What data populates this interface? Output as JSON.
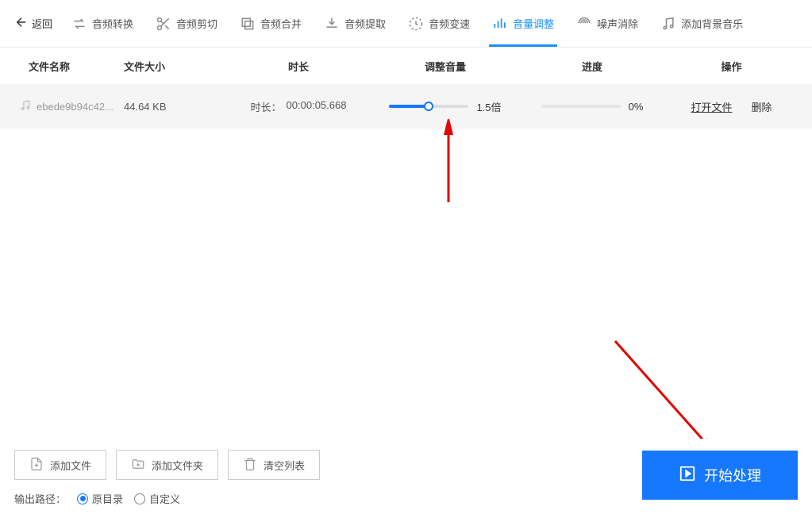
{
  "toolbar": {
    "back": "返回",
    "tabs": [
      {
        "label": "音频转换"
      },
      {
        "label": "音频剪切"
      },
      {
        "label": "音频合并"
      },
      {
        "label": "音频提取"
      },
      {
        "label": "音频变速"
      },
      {
        "label": "音量调整"
      },
      {
        "label": "噪声消除"
      },
      {
        "label": "添加背景音乐"
      }
    ]
  },
  "table": {
    "headers": {
      "name": "文件名称",
      "size": "文件大小",
      "duration": "时长",
      "volume": "调整音量",
      "progress": "进度",
      "action": "操作"
    },
    "row": {
      "filename": "ebede9b94c42...",
      "size": "44.64 KB",
      "duration_label": "时长：",
      "duration_value": "00:00:05.668",
      "volume_percent": 50,
      "volume_text": "1.5倍",
      "progress_percent": 0,
      "progress_text": "0%",
      "open": "打开文件",
      "delete": "删除"
    }
  },
  "bottom": {
    "add_file": "添加文件",
    "add_folder": "添加文件夹",
    "clear_list": "清空列表",
    "start": "开始处理",
    "output_label": "输出路径：",
    "radio_original": "原目录",
    "radio_custom": "自定义"
  }
}
